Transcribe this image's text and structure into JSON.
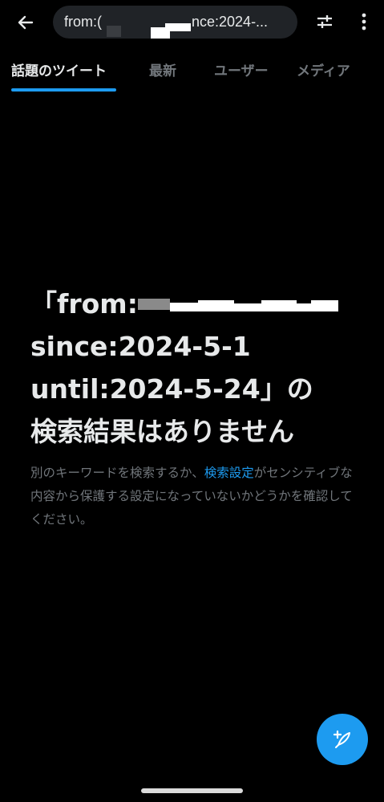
{
  "header": {
    "search_value": "from:(",
    "search_value_tail": "nce:2024-..."
  },
  "tabs": [
    {
      "label": "話題のツイート",
      "active": true
    },
    {
      "label": "最新",
      "active": false
    },
    {
      "label": "ユーザー",
      "active": false
    },
    {
      "label": "メディア",
      "active": false
    }
  ],
  "empty_state": {
    "title_line1": "「from:",
    "title_line2": "since:2024-5-1",
    "title_line3": "until:2024-5-24」の",
    "title_line4": "検索結果はありません",
    "desc_before": "別のキーワードを検索するか、",
    "desc_link": "検索設定",
    "desc_after": "がセンシティブな内容から保護する設定になっていないかどうかを確認してください。"
  },
  "colors": {
    "background": "#000000",
    "accent": "#1d9bf0",
    "text_primary": "#e7e9ea",
    "text_secondary": "#71767b",
    "search_bg": "#202327"
  },
  "icons": {
    "back": "arrow-left-icon",
    "filter": "sliders-icon",
    "more": "vertical-dots-icon",
    "compose": "feather-plus-icon"
  }
}
